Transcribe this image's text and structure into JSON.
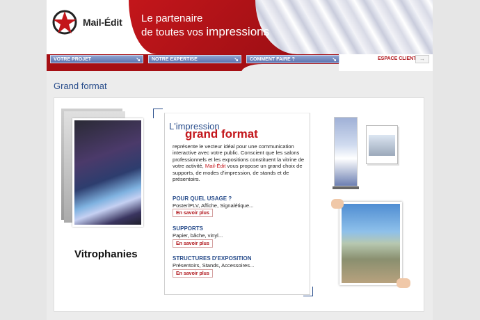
{
  "brand": {
    "name": "Mail-Édit",
    "tagline_line1": "Le partenaire",
    "tagline_line2_prefix": "de toutes vos",
    "tagline_line2_emph": "impressions"
  },
  "nav": {
    "items": [
      {
        "label": "VOTRE PROJET"
      },
      {
        "label": "NOTRE EXPERTISE"
      },
      {
        "label": "COMMENT FAIRE ?"
      }
    ],
    "espace_clients": "ESPACE CLIENTS"
  },
  "page": {
    "title": "Grand format"
  },
  "left": {
    "caption": "Vitrophanies"
  },
  "center": {
    "heading_small": "L'impression",
    "heading_big": "grand format",
    "intro_part1": "représente le vecteur idéal pour une communication interactive avec votre public. Conscient que les salons professionnels et les expositions constituent la vitrine de votre activité,",
    "intro_brand": "Mail-Édit",
    "intro_part2": "vous propose un grand choix de supports, de modes d'impression, de stands et de présentoirs.",
    "sections": [
      {
        "title": "POUR QUEL USAGE ?",
        "sub": "Poster/PLV, Affiche, Signalétique...",
        "button": "En savoir plus"
      },
      {
        "title": "SUPPORTS",
        "sub": "Papier, bâche, vinyl...",
        "button": "En savoir plus"
      },
      {
        "title": "STRUCTURES D'EXPOSITION",
        "sub": "Présentoirs, Stands, Accessoires...",
        "button": "En savoir plus"
      }
    ]
  },
  "colors": {
    "brand_red": "#c3161b",
    "nav_blue": "#5d74b0",
    "title_blue": "#2a4e8c"
  }
}
